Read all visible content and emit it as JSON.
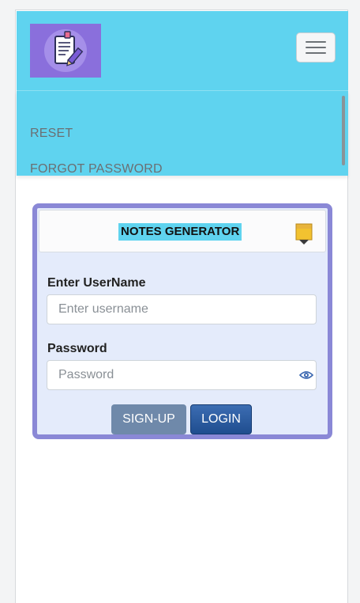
{
  "navbar": {
    "logo_icon": "notepad-pen-icon",
    "toggler_icon": "hamburger-icon"
  },
  "menu": {
    "items": [
      {
        "label": "RESET"
      },
      {
        "label": "FORGOT PASSWORD"
      }
    ]
  },
  "card": {
    "title": "NOTES GENERATOR",
    "title_icon": "pencil-icon",
    "username": {
      "label": "Enter UserName",
      "placeholder": "Enter username",
      "value": ""
    },
    "password": {
      "label": "Password",
      "placeholder": "Password",
      "value": "",
      "toggle_icon": "eye-icon"
    },
    "buttons": {
      "signup": "SIGN-UP",
      "login": "LOGIN"
    }
  },
  "colors": {
    "navbar_bg": "#5fd3ef",
    "card_border": "#8a88d6",
    "card_bg": "#e4ebfb",
    "login_btn": "#2a5a9e",
    "signup_btn": "#6f89aa",
    "logo_bg": "#8a6fdc"
  }
}
